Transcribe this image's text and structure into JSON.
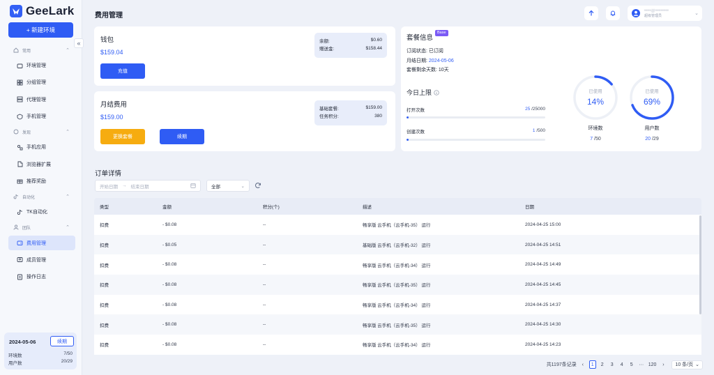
{
  "app": {
    "name": "GeeLark",
    "new_env_label": "+ 新建环境",
    "collapse_glyph": "«"
  },
  "sidebar": {
    "groups": [
      {
        "label": "常用",
        "icon": "home-icon",
        "items": [
          {
            "label": "环境管理",
            "icon": "folder-icon"
          },
          {
            "label": "分组管理",
            "icon": "grid-icon"
          },
          {
            "label": "代理管理",
            "icon": "server-icon"
          },
          {
            "label": "手机管理",
            "icon": "phone-icon"
          }
        ]
      },
      {
        "label": "发现",
        "icon": "compass-icon",
        "items": [
          {
            "label": "手机应用",
            "icon": "apps-icon"
          },
          {
            "label": "浏览器扩展",
            "icon": "puzzle-icon"
          },
          {
            "label": "推荐奖励",
            "icon": "gift-icon"
          }
        ]
      },
      {
        "label": "自动化",
        "icon": "tiktok-icon",
        "items": [
          {
            "label": "TK自动化",
            "icon": "tiktok-icon"
          }
        ]
      },
      {
        "label": "团队",
        "icon": "team-icon",
        "items": [
          {
            "label": "费用管理",
            "icon": "wallet-icon",
            "active": true
          },
          {
            "label": "成员管理",
            "icon": "user-icon"
          },
          {
            "label": "操作日志",
            "icon": "log-icon"
          }
        ]
      }
    ],
    "plan": {
      "date": "2024-05-06",
      "renew_label": "续期",
      "env_label": "环境数",
      "env_value": "7/50",
      "user_label": "用户数",
      "user_value": "20/29"
    }
  },
  "header": {
    "title": "费用管理",
    "user_name": "••••@••••••••",
    "user_role": "超级管理员"
  },
  "wallet": {
    "title": "钱包",
    "amount": "$159.04",
    "recharge_label": "充值",
    "balance_label": "余额:",
    "balance_value": "$0.60",
    "gift_label": "赠送金:",
    "gift_value": "$158.44"
  },
  "monthly": {
    "title": "月结费用",
    "amount": "$159.00",
    "change_label": "更换套餐",
    "renew_label": "续期",
    "base_label": "基础套餐:",
    "base_value": "$159.00",
    "task_label": "任务积分:",
    "task_value": "380"
  },
  "package": {
    "title": "套餐信息",
    "badge": "Base",
    "status_label": "订阅状态:",
    "status_value": "已订阅",
    "date_label": "月结日期:",
    "date_value": "2024-05-06",
    "days_label": "套餐剩余天数:",
    "days_value": "10天",
    "today_title": "今日上限",
    "limits": [
      {
        "label": "打开次数",
        "current": "25",
        "total": " /25000",
        "fraction": 0.001
      },
      {
        "label": "创建次数",
        "current": "1",
        "total": " /500",
        "fraction": 0.002
      }
    ],
    "rings": [
      {
        "used_label": "已使用",
        "percent": "14%",
        "fraction": 0.14,
        "name": "环境数",
        "current": "7",
        "total": " /50"
      },
      {
        "used_label": "已使用",
        "percent": "69%",
        "fraction": 0.69,
        "name": "用户数",
        "current": "20",
        "total": " /29"
      }
    ]
  },
  "orders": {
    "title": "订单详情",
    "start_placeholder": "开始日期",
    "end_placeholder": "结束日期",
    "range_arrow": "→",
    "filter_value": "全部",
    "columns": [
      "类型",
      "金额",
      "积分(个)",
      "描述",
      "日期"
    ],
    "rows": [
      [
        "扣费",
        "- $0.08",
        "--",
        "畅享版 云手机（云手机-35） 运行",
        "2024-04-25 15:00"
      ],
      [
        "扣费",
        "- $0.05",
        "--",
        "基础版 云手机（云手机-32） 运行",
        "2024-04-25 14:51"
      ],
      [
        "扣费",
        "- $0.08",
        "--",
        "畅享版 云手机（云手机-34） 运行",
        "2024-04-25 14:49"
      ],
      [
        "扣费",
        "- $0.08",
        "--",
        "畅享版 云手机（云手机-35） 运行",
        "2024-04-25 14:45"
      ],
      [
        "扣费",
        "- $0.08",
        "--",
        "畅享版 云手机（云手机-34） 运行",
        "2024-04-25 14:37"
      ],
      [
        "扣费",
        "- $0.08",
        "--",
        "畅享版 云手机（云手机-35） 运行",
        "2024-04-25 14:30"
      ],
      [
        "扣费",
        "- $0.08",
        "--",
        "畅享版 云手机（云手机-34） 运行",
        "2024-04-25 14:23"
      ]
    ],
    "pagination": {
      "total": "共1197条记录",
      "prev": "‹",
      "pages": [
        "1",
        "2",
        "3",
        "4",
        "5"
      ],
      "ellipsis": "···",
      "last": "120",
      "next": "›",
      "size": "10 条/页"
    }
  },
  "colors": {
    "accent": "#2f5cf4",
    "orange": "#f6ac10",
    "badge": "#7a5af5",
    "background": "#eef1f8"
  }
}
